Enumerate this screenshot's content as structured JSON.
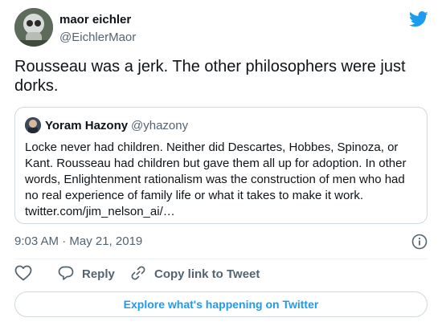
{
  "author": {
    "name": "maor eichler",
    "handle": "@EichlerMaor"
  },
  "tweet": {
    "text": "Rousseau was a jerk. The other philosophers were just dorks."
  },
  "quoted_tweet": {
    "author_name": "Yoram Hazony",
    "author_handle": "@yhazony",
    "lines": [
      "Locke never had children. Neither did Descartes, Hobbes, Spinoza, or",
      "Kant. Rousseau had children but gave them all up for adoption. In other",
      "words, Enlightenment rationalism was the construction of men who had",
      "no real experience of family life or what it takes to make it work.",
      "twitter.com/jim_nelson_ai/…"
    ]
  },
  "meta": {
    "timestamp": "9:03 AM · May 21, 2019"
  },
  "actions": {
    "reply_label": "Reply",
    "copy_label": "Copy link to Tweet"
  },
  "footer": {
    "explore_label": "Explore what's happening on Twitter"
  },
  "icons": {
    "brand": "twitter-bird-icon",
    "info": "info-icon",
    "like": "heart-icon",
    "reply": "reply-icon",
    "copy": "link-icon"
  },
  "colors": {
    "brand": "#1d9bf0",
    "text": "#0f1419",
    "secondary": "#536471",
    "border": "#cfd9de"
  }
}
